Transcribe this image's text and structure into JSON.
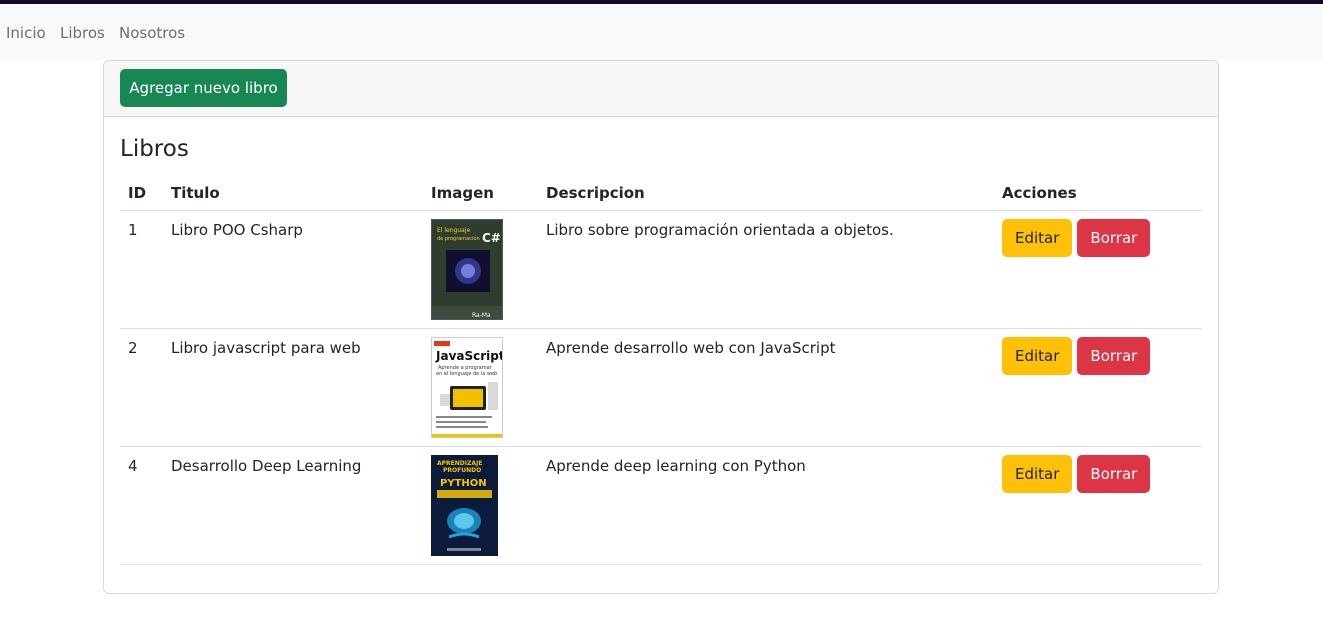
{
  "nav": {
    "items": [
      "Inicio",
      "Libros",
      "Nosotros"
    ]
  },
  "card": {
    "add_button": "Agregar nuevo libro",
    "title": "Libros"
  },
  "table": {
    "headers": [
      "ID",
      "Titulo",
      "Imagen",
      "Descripcion",
      "Acciones"
    ],
    "rows": [
      {
        "id": "1",
        "title": "Libro POO Csharp",
        "cover_text": [
          "El lenguaje",
          "de programación",
          "C#",
          "Ra-Ma"
        ],
        "description": "Libro sobre programación orientada a objetos."
      },
      {
        "id": "2",
        "title": "Libro javascript para web",
        "cover_text": [
          "JavaScript",
          "Aprende a programar",
          "en el lenguaje de la web"
        ],
        "description": "Aprende desarrollo web con JavaScript"
      },
      {
        "id": "4",
        "title": "Desarrollo Deep Learning",
        "cover_text": [
          "APRENDIZAJE",
          "PROFUNDO",
          "PYTHON"
        ],
        "description": "Aprende deep learning con Python"
      }
    ],
    "edit_label": "Editar",
    "delete_label": "Borrar"
  },
  "colors": {
    "success": "#198754",
    "warning": "#ffc107",
    "danger": "#dc3545",
    "navbar_bg": "#f8f9fa"
  }
}
